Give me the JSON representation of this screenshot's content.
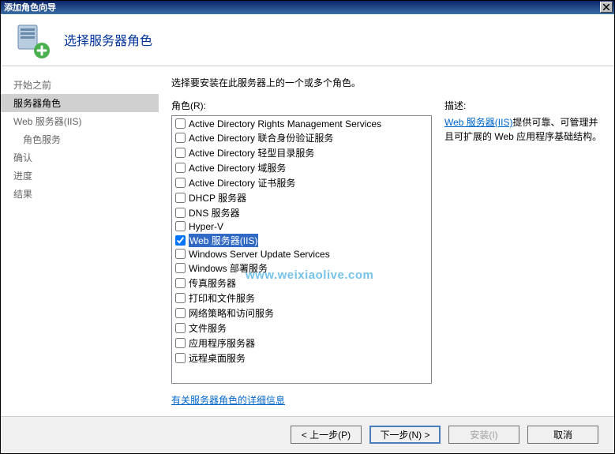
{
  "titlebar": {
    "text": "添加角色向导"
  },
  "header": {
    "title": "选择服务器角色"
  },
  "sidebar": {
    "items": [
      {
        "label": "开始之前",
        "indent": 0,
        "selected": false
      },
      {
        "label": "服务器角色",
        "indent": 0,
        "selected": true
      },
      {
        "label": "Web 服务器(IIS)",
        "indent": 0,
        "selected": false
      },
      {
        "label": "角色服务",
        "indent": 1,
        "selected": false
      },
      {
        "label": "确认",
        "indent": 0,
        "selected": false
      },
      {
        "label": "进度",
        "indent": 0,
        "selected": false
      },
      {
        "label": "结果",
        "indent": 0,
        "selected": false
      }
    ]
  },
  "main": {
    "instruction": "选择要安装在此服务器上的一个或多个角色。",
    "roles_label": "角色(R):",
    "desc_label": "描述:",
    "roles": [
      {
        "label": "Active Directory Rights Management Services",
        "checked": false,
        "selected": false
      },
      {
        "label": "Active Directory 联合身份验证服务",
        "checked": false,
        "selected": false
      },
      {
        "label": "Active Directory 轻型目录服务",
        "checked": false,
        "selected": false
      },
      {
        "label": "Active Directory 域服务",
        "checked": false,
        "selected": false
      },
      {
        "label": "Active Directory 证书服务",
        "checked": false,
        "selected": false
      },
      {
        "label": "DHCP 服务器",
        "checked": false,
        "selected": false
      },
      {
        "label": "DNS 服务器",
        "checked": false,
        "selected": false
      },
      {
        "label": "Hyper-V",
        "checked": false,
        "selected": false
      },
      {
        "label": "Web 服务器(IIS)",
        "checked": true,
        "selected": true
      },
      {
        "label": "Windows Server Update Services",
        "checked": false,
        "selected": false
      },
      {
        "label": "Windows 部署服务",
        "checked": false,
        "selected": false
      },
      {
        "label": "传真服务器",
        "checked": false,
        "selected": false
      },
      {
        "label": "打印和文件服务",
        "checked": false,
        "selected": false
      },
      {
        "label": "网络策略和访问服务",
        "checked": false,
        "selected": false
      },
      {
        "label": "文件服务",
        "checked": false,
        "selected": false
      },
      {
        "label": "应用程序服务器",
        "checked": false,
        "selected": false
      },
      {
        "label": "远程桌面服务",
        "checked": false,
        "selected": false
      }
    ],
    "more_info_link": "有关服务器角色的详细信息",
    "description": {
      "link": "Web 服务器(IIS)",
      "text": "提供可靠、可管理并且可扩展的 Web 应用程序基础结构。"
    }
  },
  "footer": {
    "prev": "< 上一步(P)",
    "next": "下一步(N) >",
    "install": "安装(I)",
    "cancel": "取消"
  },
  "watermark": "www.weixiaolive.com"
}
